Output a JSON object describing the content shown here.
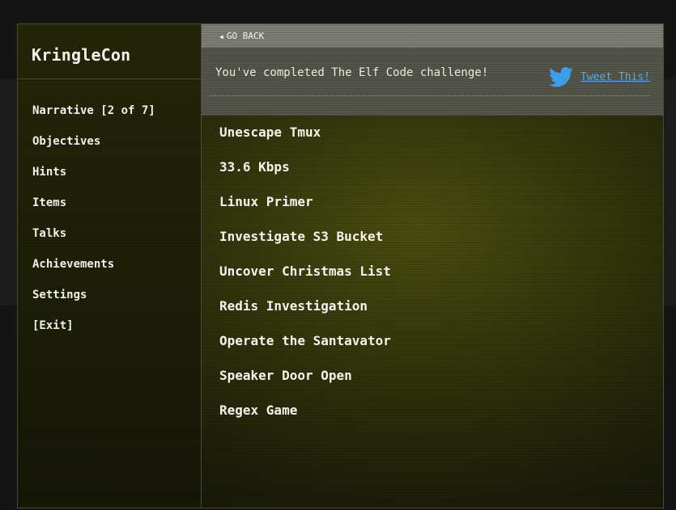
{
  "app": {
    "title": "KringleCon"
  },
  "sidebar": {
    "items": [
      {
        "label": "Narrative [2 of 7]"
      },
      {
        "label": "Objectives"
      },
      {
        "label": "Hints"
      },
      {
        "label": "Items"
      },
      {
        "label": "Talks"
      },
      {
        "label": "Achievements"
      },
      {
        "label": "Settings"
      },
      {
        "label": "[Exit]"
      }
    ]
  },
  "header": {
    "go_back_label": "GO BACK",
    "go_back_icon": "triangle-left-icon"
  },
  "completion": {
    "message": "You've completed The Elf Code challenge!",
    "tweet_label": "Tweet This!",
    "tweet_icon": "twitter-bird-icon",
    "tweet_color": "#5aa8ea"
  },
  "objectives": [
    {
      "label": "Unescape Tmux"
    },
    {
      "label": "33.6 Kbps"
    },
    {
      "label": "Linux Primer"
    },
    {
      "label": "Investigate S3 Bucket"
    },
    {
      "label": "Uncover Christmas List"
    },
    {
      "label": "Redis Investigation"
    },
    {
      "label": "Operate the Santavator"
    },
    {
      "label": "Speaker Door Open"
    },
    {
      "label": "Regex Game"
    }
  ]
}
